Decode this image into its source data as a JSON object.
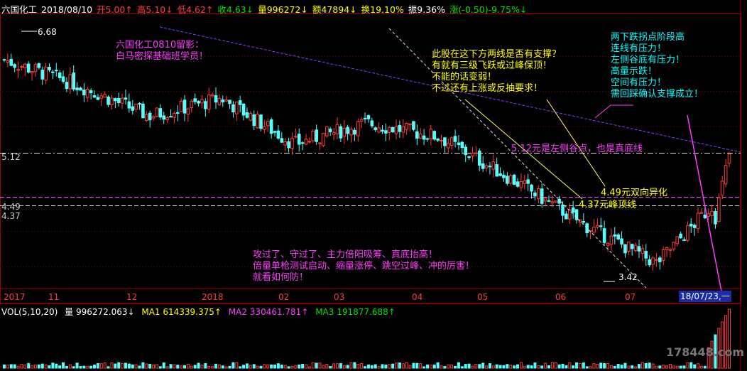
{
  "header": {
    "name": "六国化工",
    "date": "2018/08/10",
    "open": "开5.00↑",
    "high": "高5.10↓",
    "low": "低4.62↑",
    "close": "收4.63↓",
    "volume": "量996272↓",
    "amount": "额47894↓",
    "turnover": "换19.10%",
    "amplitude": "振9.36%",
    "change": "涨(-0.50)-9.75%↓"
  },
  "annotations": {
    "leave_shadow": "六国化工0810留影：\n白马密探基础班学员！",
    "question": "此股在这下方两线是否有支撑？\n有就有三级飞跃或过峰保顶！\n不能的话变弱！\n不过还有上涨或反抽要求！",
    "right_note": "两下跌拐点阶段高\n连线有压力！\n左侧谷底有压力！\n高量示跌！\n空间有压力！\n需回踩确认支撑成立！",
    "line_512": "5.12元是左侧谷点，也是真底线",
    "line_449": "4.49元双向异化",
    "line_437": "4.37元峰顶线",
    "bottom_note": "攻过了、守过了、主力倍阳吸筹、真底抬高！\n倍量单枪测试启动、缩量涨停、跳空过峰、冲的厉害！\n就看如何防！"
  },
  "price_labels": {
    "high_mark": "6.68",
    "low_mark": "3.42",
    "axis_512": "5.12",
    "axis_449": "4.49",
    "axis_437": "4.37"
  },
  "x_axis": {
    "labels": [
      "2017",
      "11",
      "12",
      "2018",
      "02",
      "03",
      "04",
      "05",
      "06",
      "07"
    ],
    "cursor_date": "18/07/23,一"
  },
  "volume_header": {
    "title": "VOL(5,10,20)",
    "vol": "量 996272.063↓",
    "ma1": "MA1 614339.375↑",
    "ma2": "MA2 330461.781↑",
    "ma3": "MA3 191877.688↑"
  },
  "watermark": "178448.com",
  "colors": {
    "up": "#ff3b3b",
    "down": "#54ffff",
    "annotation": "#ff3cff",
    "dashline": "#ff3b3b",
    "trendline": "#8040ff"
  },
  "chart_data": {
    "type": "candlestick",
    "title": "",
    "xlabel": "",
    "ylabel": "",
    "ylim": [
      3.2,
      7.1
    ],
    "x": [
      "2017-10",
      "2017-11",
      "2017-12",
      "2018-01",
      "2018-02",
      "2018-03",
      "2018-04",
      "2018-05",
      "2018-06",
      "2018-07",
      "2018-08"
    ],
    "close_approx": [
      6.45,
      6.1,
      5.65,
      5.9,
      5.25,
      5.55,
      5.35,
      4.75,
      4.1,
      3.55,
      4.63
    ],
    "reference_lines": [
      5.12,
      4.49,
      4.37
    ],
    "marked_extremes": {
      "high": 6.68,
      "low": 3.42
    },
    "last_bar": {
      "date": "2018/08/10",
      "open": 5.0,
      "high": 5.1,
      "low": 4.62,
      "close": 4.63,
      "volume": 996272
    },
    "volume_ma": {
      "MA1": 614339.375,
      "MA2": 330461.781,
      "MA3": 191877.688
    }
  }
}
